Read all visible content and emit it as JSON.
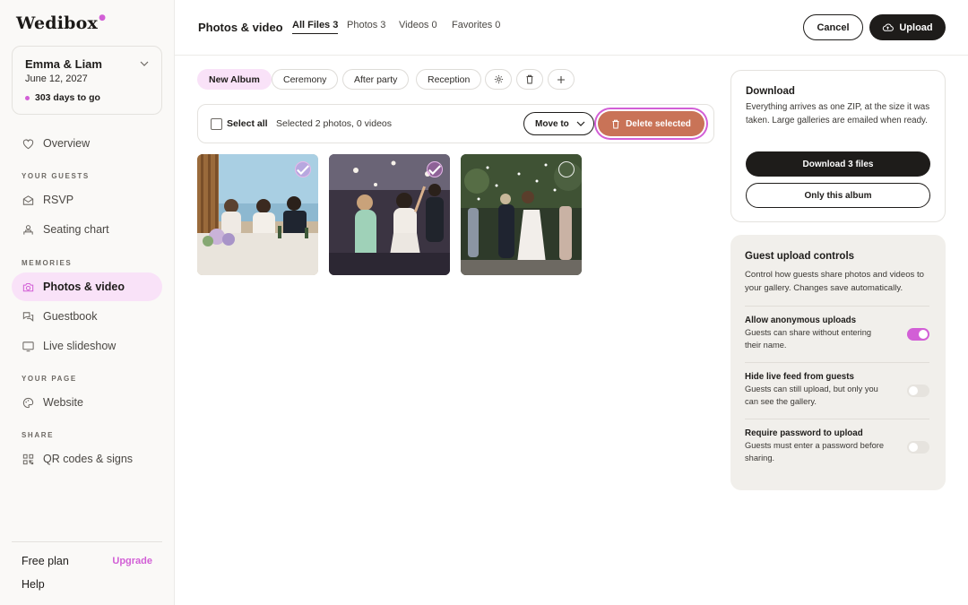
{
  "app": {
    "logo": "Wedibox"
  },
  "event": {
    "name": "Emma & Liam",
    "date": "June 12, 2027",
    "countdown": "303 days to go"
  },
  "sidebar": {
    "overview": "Overview",
    "sections": {
      "guests": "YOUR GUESTS",
      "memories": "MEMORIES",
      "page": "YOUR PAGE",
      "share": "SHARE"
    },
    "items": {
      "rsvp": "RSVP",
      "seating": "Seating chart",
      "photos": "Photos & video",
      "guestbook": "Guestbook",
      "slideshow": "Live slideshow",
      "website": "Website",
      "qr": "QR codes & signs"
    },
    "plan": "Free plan",
    "upgrade": "Upgrade",
    "help": "Help"
  },
  "header": {
    "title": "Photos & video",
    "tabs": {
      "all": "All Files 3",
      "photos": "Photos 3",
      "videos": "Videos 0",
      "favorites": "Favorites 0"
    },
    "cancel": "Cancel",
    "upload": "Upload"
  },
  "albums": {
    "new": "New Album",
    "ceremony": "Ceremony",
    "after_party": "After party",
    "reception": "Reception"
  },
  "selection": {
    "select_all": "Select all",
    "count": "Selected 2 photos, 0 videos",
    "move_to": "Move to",
    "delete": "Delete selected"
  },
  "photos": [
    {
      "selected": true
    },
    {
      "selected": true
    },
    {
      "selected": false
    }
  ],
  "download": {
    "title": "Download",
    "description": "Everything arrives as one ZIP, at the size it was taken. Large galleries are emailed when ready.",
    "download_button": "Download 3 files",
    "album_button": "Only this album"
  },
  "guest_controls": {
    "title": "Guest upload controls",
    "description": "Control how guests share photos and videos to your gallery. Changes save automatically.",
    "settings": {
      "anonymous": {
        "title": "Allow anonymous uploads",
        "description": "Guests can share without entering their name.",
        "enabled": true
      },
      "hide_feed": {
        "title": "Hide live feed from guests",
        "description": "Guests can still upload, but only you can see the gallery.",
        "enabled": false
      },
      "password": {
        "title": "Require password to upload",
        "description": "Guests must enter a password before sharing.",
        "enabled": false
      }
    }
  },
  "colors": {
    "accent": "#d25fd6",
    "accent_soft": "#f9e2f8",
    "delete": "#c97357",
    "dark": "#1e1c1a",
    "panel": "#f1efeb"
  }
}
